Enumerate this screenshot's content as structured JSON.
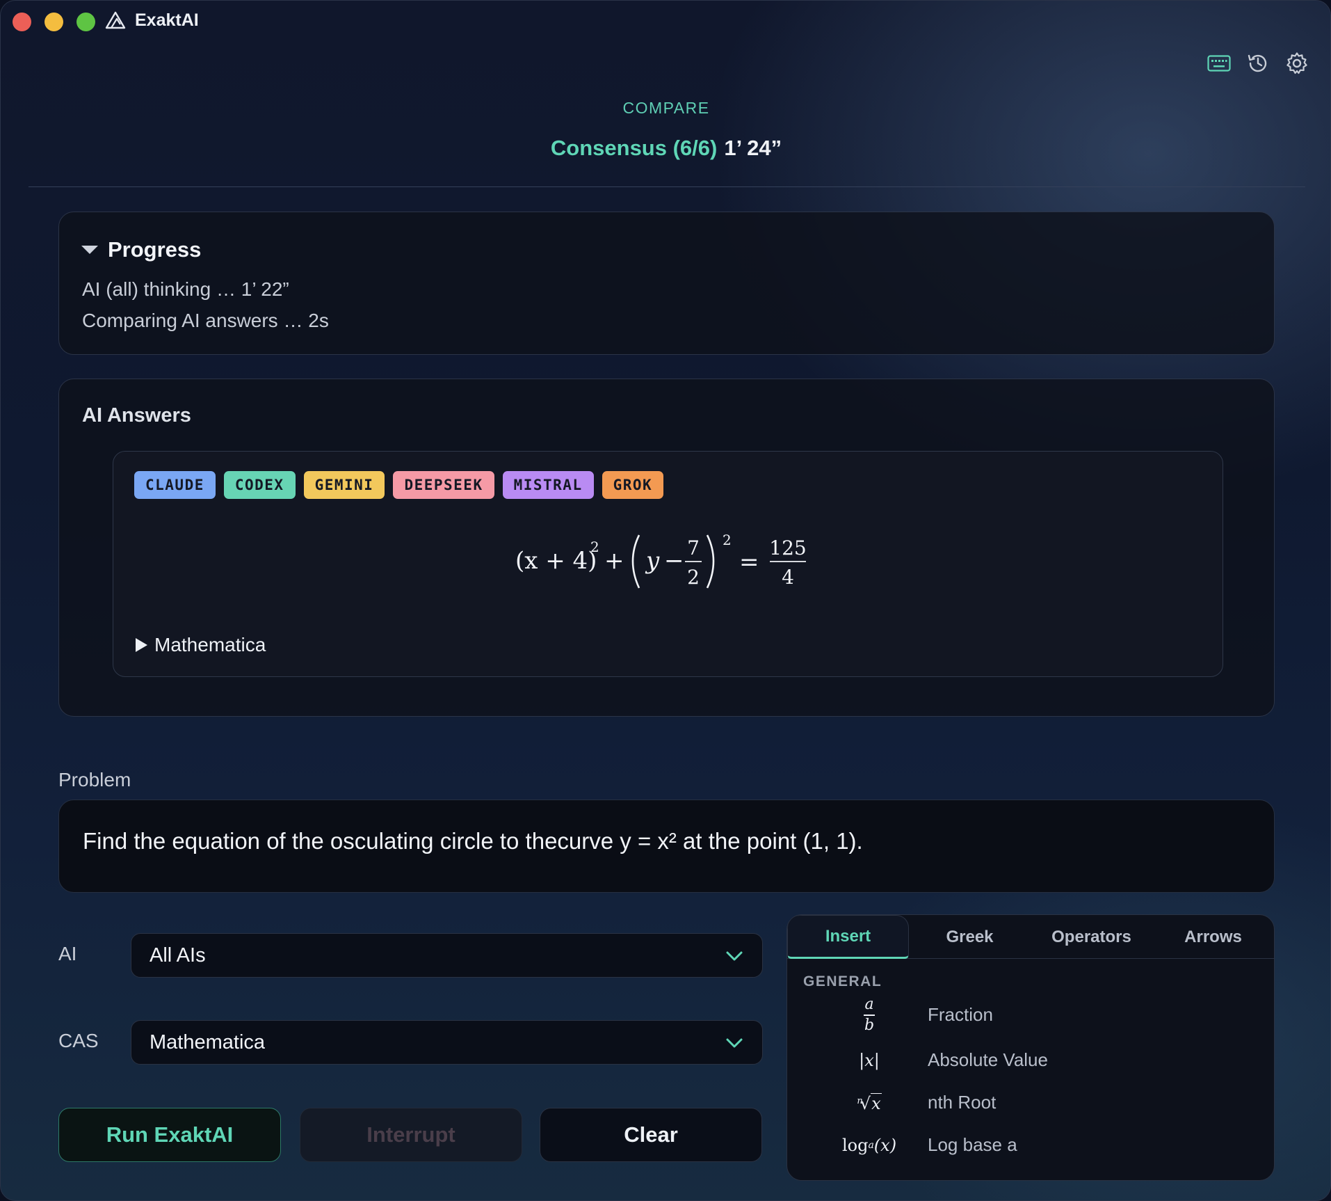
{
  "app": {
    "title": "ExaktAI"
  },
  "toolbar": {
    "icons": [
      "keyboard-icon",
      "history-icon",
      "settings-icon"
    ]
  },
  "header": {
    "mode": "COMPARE",
    "consensus": "Consensus (6/6)",
    "elapsed": "1’ 24”"
  },
  "progress": {
    "title": "Progress",
    "lines": [
      "AI (all) thinking … 1’ 22”",
      "Comparing AI answers … 2s"
    ]
  },
  "answers": {
    "title": "AI Answers",
    "tags": [
      {
        "label": "CLAUDE",
        "color": "#7aa7f4"
      },
      {
        "label": "CODEX",
        "color": "#67d4b4"
      },
      {
        "label": "GEMINI",
        "color": "#f2c85c"
      },
      {
        "label": "DEEPSEEK",
        "color": "#f59aa6"
      },
      {
        "label": "MISTRAL",
        "color": "#b98bf3"
      },
      {
        "label": "GROK",
        "color": "#f39a52"
      }
    ],
    "formula": {
      "lhs_base": "(x + 4)",
      "exp1": "2",
      "plus": "+",
      "y": "y",
      "minus": "−",
      "frac_num": "7",
      "frac_den": "2",
      "exp2": "2",
      "equals": "=",
      "rhs_num": "125",
      "rhs_den": "4"
    },
    "toggle_label": "Mathematica"
  },
  "problem": {
    "label": "Problem",
    "text": "Find the equation of the osculating circle to thecurve y = x² at the point (1, 1)."
  },
  "ai_select": {
    "label": "AI",
    "value": "All AIs"
  },
  "cas_select": {
    "label": "CAS",
    "value": "Mathematica"
  },
  "buttons": {
    "run": "Run ExaktAI",
    "interrupt": "Interrupt",
    "clear": "Clear"
  },
  "palette": {
    "tabs": [
      "Insert",
      "Greek",
      "Operators",
      "Arrows"
    ],
    "active_tab": "Insert",
    "group": "GENERAL",
    "items": [
      {
        "label": "Fraction",
        "symbol_num": "a",
        "symbol_den": "b"
      },
      {
        "label": "Absolute Value",
        "symbol": "|x|"
      },
      {
        "label": "nth Root",
        "symbol_index": "n",
        "symbol": "x"
      },
      {
        "label": "Log base a",
        "symbol": "log",
        "symbol_sub": "a",
        "symbol_arg": "(x)"
      }
    ]
  },
  "colors": {
    "accent": "#5fd6b6",
    "background": "#10172c"
  }
}
